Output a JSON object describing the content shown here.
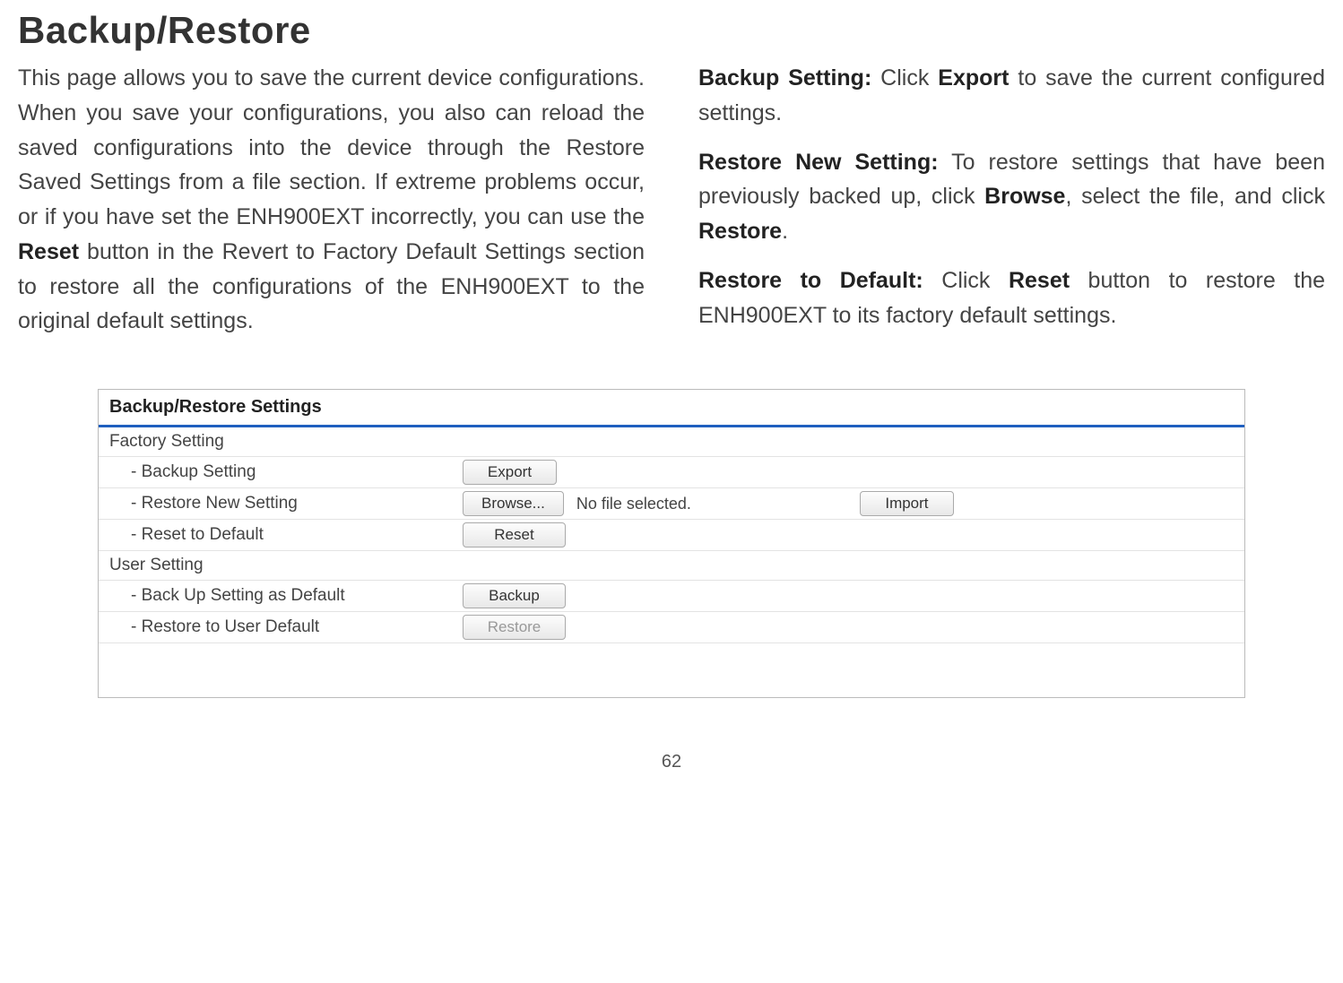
{
  "page": {
    "title": "Backup/Restore",
    "intro": "This page allows you to save the current device configurations. When you save your configurations, you also can reload the saved configurations into the device through the Restore Saved Settings from a file section. If extreme problems occur, or if you have set the ENH900EXT incorrectly, you can use the ",
    "intro_bold1": "Reset",
    "intro_after1": " button in the Revert to Factory Default Settings section to restore all the configurations of the ENH900EXT to the original default settings.",
    "backup_label": "Backup Setting:",
    "backup_text_before": " Click ",
    "backup_bold": "Export",
    "backup_text_after": " to save the current configured settings.",
    "restore_new_label": "Restore New Setting:",
    "restore_new_text_before": " To restore settings that have been previously backed up, click ",
    "restore_new_bold1": "Browse",
    "restore_new_mid": ", select the file, and click ",
    "restore_new_bold2": "Restore",
    "restore_new_after": ".",
    "restore_default_label": "Restore to Default:",
    "restore_default_before": " Click ",
    "restore_default_bold": "Reset",
    "restore_default_after": " button to restore the ENH900EXT to its factory default settings."
  },
  "panel": {
    "header": "Backup/Restore Settings",
    "factory_section": "Factory Setting",
    "user_section": "User Setting",
    "rows": {
      "backup": {
        "label": "- Backup Setting",
        "button": "Export"
      },
      "restore_new": {
        "label": "- Restore New Setting",
        "browse": "Browse...",
        "file_text": "No file selected.",
        "import": "Import"
      },
      "reset": {
        "label": "- Reset to Default",
        "button": "Reset"
      },
      "backup_user": {
        "label": "- Back Up Setting as Default",
        "button": "Backup"
      },
      "restore_user": {
        "label": "- Restore to User Default",
        "button": "Restore"
      }
    }
  },
  "page_number": "62"
}
